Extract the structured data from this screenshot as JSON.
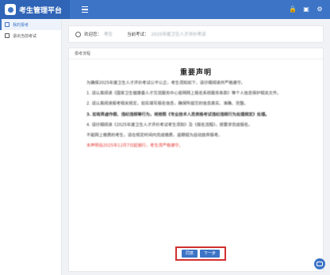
{
  "app": {
    "title": "考生管理平台"
  },
  "topbar": {
    "icons": [
      "lock-icon",
      "bell-icon",
      "settings-icon"
    ]
  },
  "sidebar": {
    "items": [
      {
        "label": "我的报考",
        "icon": "folder-icon",
        "active": true
      },
      {
        "label": "退出当前考试",
        "icon": "exit-icon",
        "active": false
      }
    ]
  },
  "infobar": {
    "welcome_label": "欢迎您：",
    "welcome_value": "考生",
    "exam_label": "当前考试：",
    "exam_value": "2025年度卫生人才评价考试"
  },
  "card": {
    "head": "报考流程",
    "title": "重要声明",
    "paragraphs": [
      "为确保2025年度卫生人才评价考试公平公正，考生须知如下，请仔细阅读并严格遵守。",
      "1. 请认真阅读《国家卫生健康委人才交流服务中心官网网上报名系统服务条款》等个人信息保护相关文件。",
      "2. 请认真阅读报考相关规定，如实填写报名信息，确保所提交的信息真实、准确、完整。",
      "3. 如有弄虚作假、违纪违规等行为，将按照《专业技术人员资格考试违纪违规行为处理规定》处理。",
      "4. 请仔细阅读《2025年度卫生人才评价考试考生须知》及《报名流程》，按要求完成报名。",
      "不能网上缴费的考生，请在规定时间内完成缴费，逾期视为自动放弃报考。",
      "本声明自2025年12月7日起施行，考生须严格遵守。"
    ]
  },
  "buttons": {
    "back": "同意",
    "next": "下一步"
  }
}
